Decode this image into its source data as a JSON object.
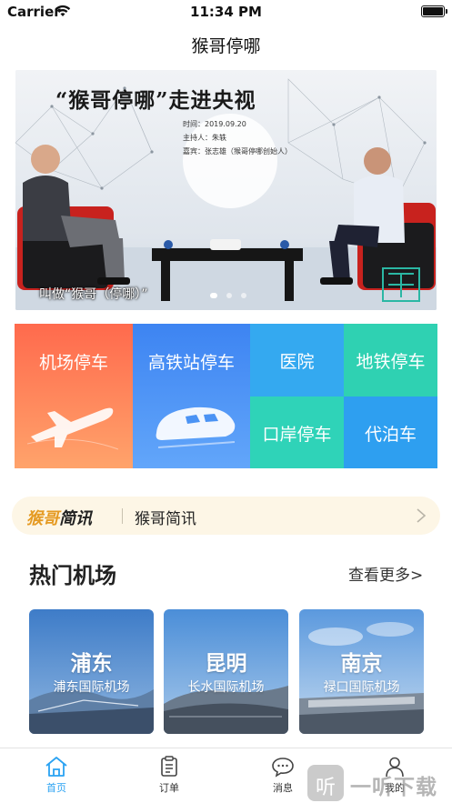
{
  "status_bar": {
    "carrier": "Carrier",
    "time": "11:34 PM"
  },
  "nav": {
    "title": "猴哥停哪"
  },
  "banner": {
    "headline": "“猴哥停哪”走进央视",
    "info_lines": [
      "时间：2019.09.20",
      "主持人：朱轶",
      "嘉宾：张志雄（猴哥停哪创始人）"
    ],
    "caption": "叫做“猴哥（停哪）”",
    "slide_count": 3,
    "active_slide": 1
  },
  "categories": {
    "airport": "机场停车",
    "rail": "高铁站停车",
    "hospital": "医院",
    "metro": "地铁停车",
    "port": "口岸停车",
    "valet": "代泊车"
  },
  "news": {
    "logo_orange": "猴哥",
    "logo_black": "简讯",
    "text": "猴哥简讯"
  },
  "hot_airports": {
    "title": "热门机场",
    "more": "查看更多>",
    "items": [
      {
        "name": "浦东",
        "sub": "浦东国际机场"
      },
      {
        "name": "昆明",
        "sub": "长水国际机场"
      },
      {
        "name": "南京",
        "sub": "禄口国际机场"
      }
    ]
  },
  "tabbar": {
    "items": [
      {
        "label": "首页",
        "icon": "home-icon"
      },
      {
        "label": "订单",
        "icon": "order-icon"
      },
      {
        "label": "消息",
        "icon": "message-icon"
      },
      {
        "label": "我的",
        "icon": "profile-icon"
      }
    ],
    "active_color": "#2aa2f2"
  },
  "watermark": {
    "badge": "听",
    "text": "一听下载"
  },
  "colors": {
    "airport_tile": "#ff6a4d",
    "rail_tile": "#3d84f2",
    "hospital_tile": "#34a9f0",
    "metro_tile": "#2fd1b2",
    "port_tile": "#2fd3b8",
    "valet_tile": "#2e9ff0",
    "news_bg": "#fdf6e6",
    "news_logo": "#e59a22"
  }
}
